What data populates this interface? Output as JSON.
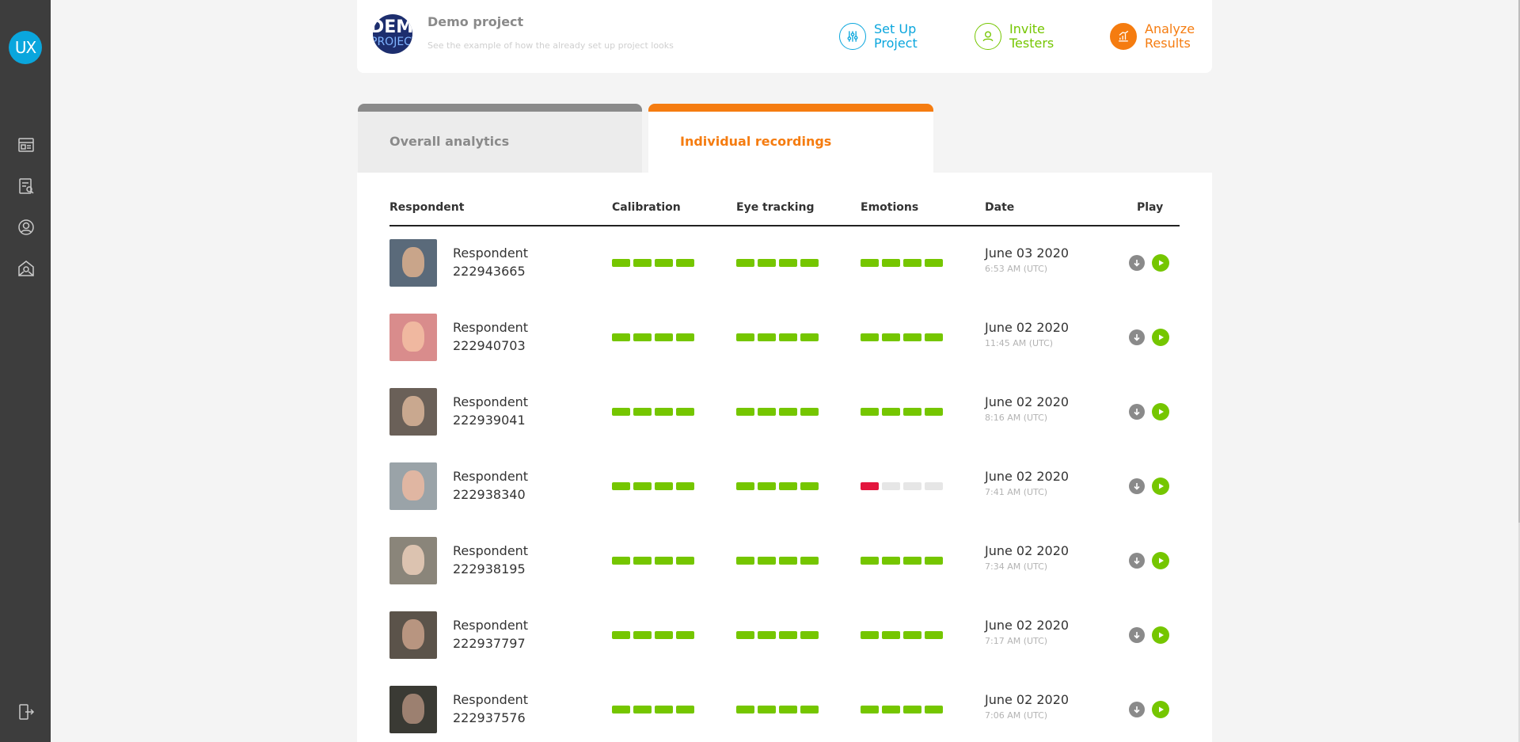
{
  "app": {
    "logo_text": "UX"
  },
  "sidebar": {
    "items": [
      {
        "icon": "projects-icon"
      },
      {
        "icon": "reports-icon"
      },
      {
        "icon": "account-icon"
      },
      {
        "icon": "support-icon"
      }
    ],
    "logout_icon": "logout-icon"
  },
  "project": {
    "logo_line1": "DEMO",
    "logo_line2": "PROJECT",
    "title": "Demo project",
    "subtitle": "See the example of how the already set up project looks"
  },
  "steps": [
    {
      "line1": "Set Up",
      "line2": "Project",
      "color": "#0aa6dd",
      "icon": "sliders-icon"
    },
    {
      "line1": "Invite",
      "line2": "Testers",
      "color": "#75c600",
      "icon": "testers-icon"
    },
    {
      "line1": "Analyze",
      "line2": "Results",
      "color": "#f57c10",
      "icon": "chart-icon"
    }
  ],
  "tabs": {
    "overall": "Overall analytics",
    "individual": "Individual recordings",
    "active": "individual"
  },
  "table": {
    "columns": {
      "respondent": "Respondent",
      "calibration": "Calibration",
      "eye_tracking": "Eye tracking",
      "emotions": "Emotions",
      "date": "Date",
      "play": "Play"
    },
    "rows": [
      {
        "label": "Respondent",
        "id": "222943665",
        "calibration": [
          1,
          1,
          1,
          1
        ],
        "eye_tracking": [
          1,
          1,
          1,
          1
        ],
        "emotions": [
          1,
          1,
          1,
          1
        ],
        "date": "June 03 2020",
        "time": "6:53 AM (UTC)"
      },
      {
        "label": "Respondent",
        "id": "222940703",
        "calibration": [
          1,
          1,
          1,
          1
        ],
        "eye_tracking": [
          1,
          1,
          1,
          1
        ],
        "emotions": [
          1,
          1,
          1,
          1
        ],
        "date": "June 02 2020",
        "time": "11:45 AM (UTC)"
      },
      {
        "label": "Respondent",
        "id": "222939041",
        "calibration": [
          1,
          1,
          1,
          1
        ],
        "eye_tracking": [
          1,
          1,
          1,
          1
        ],
        "emotions": [
          1,
          1,
          1,
          1
        ],
        "date": "June 02 2020",
        "time": "8:16 AM (UTC)"
      },
      {
        "label": "Respondent",
        "id": "222938340",
        "calibration": [
          1,
          1,
          1,
          1
        ],
        "eye_tracking": [
          1,
          1,
          1,
          1
        ],
        "emotions": [
          2,
          0,
          0,
          0
        ],
        "date": "June 02 2020",
        "time": "7:41 AM (UTC)"
      },
      {
        "label": "Respondent",
        "id": "222938195",
        "calibration": [
          1,
          1,
          1,
          1
        ],
        "eye_tracking": [
          1,
          1,
          1,
          1
        ],
        "emotions": [
          1,
          1,
          1,
          1
        ],
        "date": "June 02 2020",
        "time": "7:34 AM (UTC)"
      },
      {
        "label": "Respondent",
        "id": "222937797",
        "calibration": [
          1,
          1,
          1,
          1
        ],
        "eye_tracking": [
          1,
          1,
          1,
          1
        ],
        "emotions": [
          1,
          1,
          1,
          1
        ],
        "date": "June 02 2020",
        "time": "7:17 AM (UTC)"
      },
      {
        "label": "Respondent",
        "id": "222937576",
        "calibration": [
          1,
          1,
          1,
          1
        ],
        "eye_tracking": [
          1,
          1,
          1,
          1
        ],
        "emotions": [
          1,
          1,
          1,
          1
        ],
        "date": "June 02 2020",
        "time": "7:06 AM (UTC)"
      }
    ]
  },
  "colors": {
    "good": "#75c600",
    "bad": "#e3173e",
    "empty": "#e6e6e6",
    "accent": "#f57c10",
    "sidebar_bg": "#3d3d3d"
  }
}
